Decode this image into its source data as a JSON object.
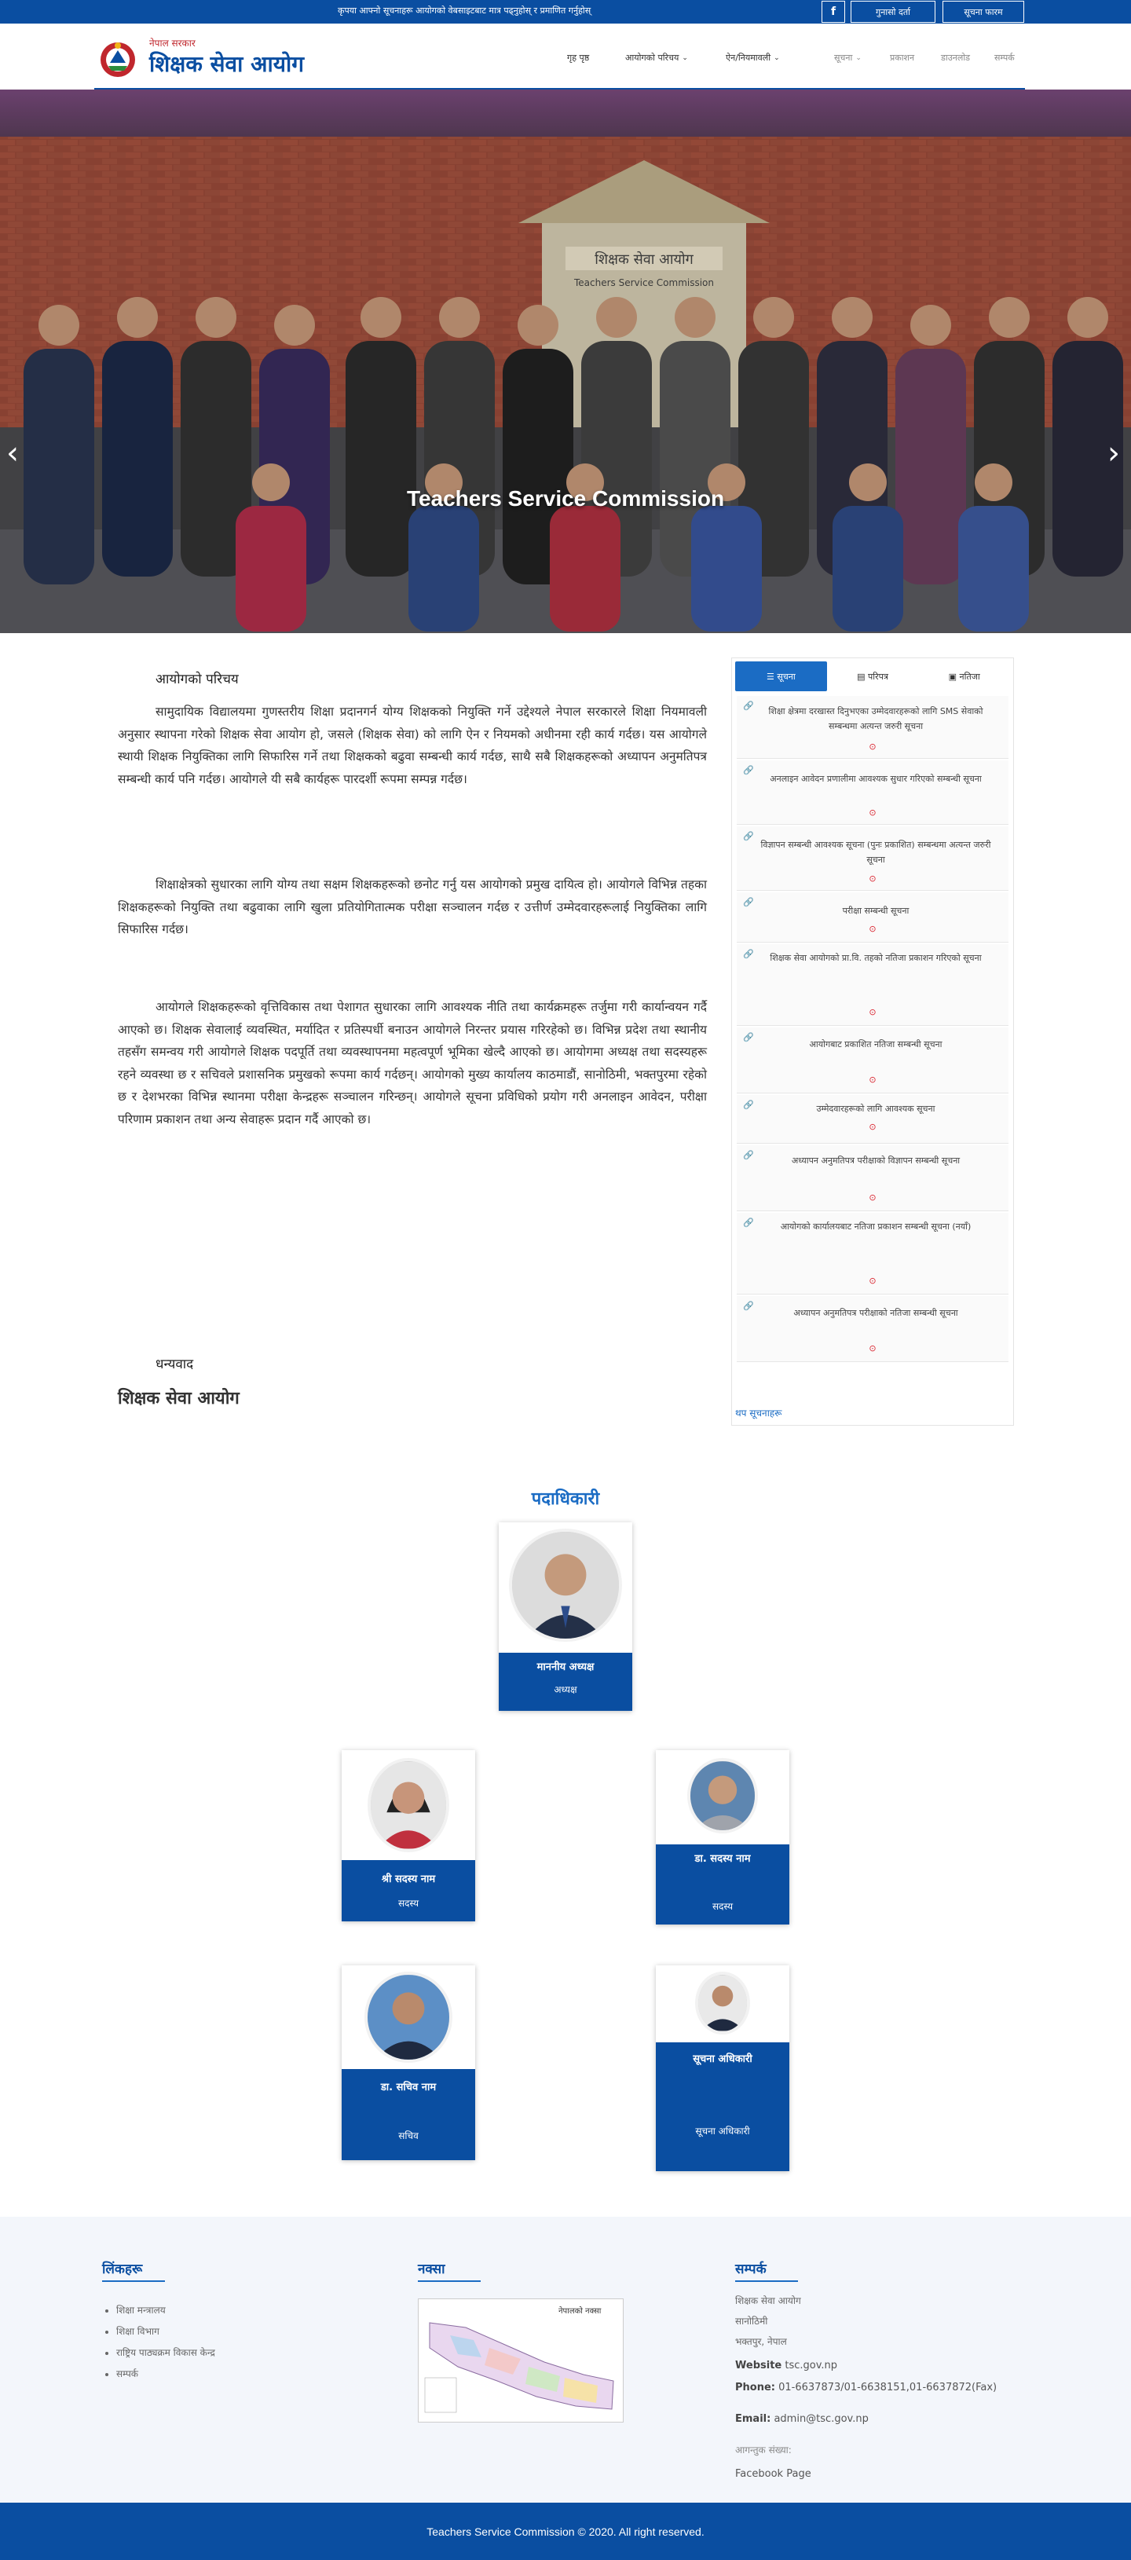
{
  "topbar": {
    "notice": "कृपया आफ्नो सूचनाहरू आयोगको वेबसाइटबाट मात्र पढ्नुहोस् र प्रमाणित गर्नुहोस्",
    "facebook_label": "f",
    "btn1": "गुनासो दर्ता",
    "btn2": "सूचना फारम"
  },
  "header": {
    "logo_small": "नेपाल सरकार",
    "logo_title": "शिक्षक सेवा आयोग",
    "nav": [
      {
        "label": "गृह पृष्ठ",
        "dropdown": false
      },
      {
        "label": "आयोगको परिचय",
        "dropdown": true
      },
      {
        "label": "ऐन/नियमावली",
        "dropdown": true
      },
      {
        "label": "सूचना",
        "dropdown": true
      },
      {
        "label": "प्रकाशन",
        "dropdown": false
      },
      {
        "label": "डाउनलोड",
        "dropdown": false
      },
      {
        "label": "सम्पर्क",
        "dropdown": false
      }
    ]
  },
  "hero": {
    "caption": "Teachers Service Commission",
    "sign_text": "शिक्षक सेवा आयोग",
    "sign_text_en": "Teachers Service Commission",
    "prev_icon": "chevron-left-icon",
    "next_icon": "chevron-right-icon"
  },
  "article": {
    "heading": "आयोगको परिचय",
    "paragraphs": [
      "सामुदायिक विद्यालयमा गुणस्तरीय शिक्षा प्रदानगर्न योग्य शिक्षकको नियुक्ति गर्ने उद्देश्यले नेपाल सरकारले शिक्षा नियमावली अनुसार स्थापना गरेको शिक्षक सेवा आयोग हो, जसले (शिक्षक सेवा) को लागि ऐन र नियमको अधीनमा रही कार्य गर्दछ। यस आयोगले स्थायी शिक्षक नियुक्तिका लागि सिफारिस गर्ने तथा शिक्षकको बढुवा सम्बन्धी कार्य गर्दछ, साथै सबै शिक्षकहरूको अध्यापन अनुमतिपत्र सम्बन्धी कार्य पनि गर्दछ। आयोगले यी सबै कार्यहरू पारदर्शी रूपमा सम्पन्न गर्दछ।",
      "शिक्षाक्षेत्रको सुधारका लागि योग्य तथा सक्षम शिक्षकहरूको छनोट गर्नु यस आयोगको प्रमुख दायित्व हो। आयोगले विभिन्न तहका शिक्षकहरूको नियुक्ति तथा बढुवाका लागि खुला प्रतियोगितात्मक परीक्षा सञ्चालन गर्दछ र उत्तीर्ण उम्मेदवारहरूलाई नियुक्तिका लागि सिफारिस गर्दछ।",
      "आयोगले शिक्षकहरूको वृत्तिविकास तथा पेशागत सुधारका लागि आवश्यक नीति तथा कार्यक्रमहरू तर्जुमा गरी कार्यान्वयन गर्दै आएको छ। शिक्षक सेवालाई व्यवस्थित, मर्यादित र प्रतिस्पर्धी बनाउन आयोगले निरन्तर प्रयास गरिरहेको छ। विभिन्न प्रदेश तथा स्थानीय तहसँग समन्वय गरी आयोगले शिक्षक पदपूर्ति तथा व्यवस्थापनमा महत्वपूर्ण भूमिका खेल्दै आएको छ। आयोगमा अध्यक्ष तथा सदस्यहरू रहने व्यवस्था छ र सचिवले प्रशासनिक प्रमुखको रूपमा कार्य गर्दछन्। आयोगको मुख्य कार्यालय काठमाडौं, सानोठिमी, भक्तपुरमा रहेको छ र देशभरका विभिन्न स्थानमा परीक्षा केन्द्रहरू सञ्चालन गरिन्छन्। आयोगले सूचना प्रविधिको प्रयोग गरी अनलाइन आवेदन, परीक्षा परिणाम प्रकाशन तथा अन्य सेवाहरू प्रदान गर्दै आएको छ।"
    ],
    "sign": "धन्यवाद",
    "big_text": "शिक्षक सेवा आयोग"
  },
  "panel": {
    "tabs": [
      {
        "label": "सूचना",
        "icon": "list-icon",
        "active": true
      },
      {
        "label": "परिपत्र",
        "icon": "document-icon",
        "active": false
      },
      {
        "label": "नतिजा",
        "icon": "briefcase-icon",
        "active": false
      }
    ],
    "notices": [
      "शिक्षा क्षेत्रमा दरखास्त दिनुभएका उम्मेदवारहरूको लागि SMS सेवाको सम्बन्धमा अत्यन्त जरुरी सूचना",
      "अनलाइन आवेदन प्रणालीमा आवश्यक सुधार गरिएको सम्बन्धी सूचना",
      "विज्ञापन सम्बन्धी आवश्यक सूचना (पुनः प्रकाशित) सम्बन्धमा अत्यन्त जरुरी सूचना",
      "परीक्षा सम्बन्धी सूचना",
      "शिक्षक सेवा आयोगको प्रा.वि. तहको नतिजा प्रकाशन गरिएको सूचना",
      "आयोगबाट प्रकाशित नतिजा सम्बन्धी सूचना",
      "उम्मेदवारहरूको लागि आवश्यक सूचना",
      "अध्यापन अनुमतिपत्र परीक्षाको विज्ञापन सम्बन्धी सूचना",
      "आयोगको कार्यालयबाट नतिजा प्रकाशन सम्बन्धी सूचना (नयाँ)",
      "अध्यापन अनुमतिपत्र परीक्षाको नतिजा सम्बन्धी सूचना"
    ],
    "more": "थप सूचनाहरू"
  },
  "officials": {
    "title": "पदाधिकारी",
    "people": [
      {
        "name": "माननीय अध्यक्ष",
        "role": "अध्यक्ष"
      },
      {
        "name": "श्री सदस्य नाम",
        "role": "सदस्य"
      },
      {
        "name": "डा. सदस्य नाम",
        "role": "सदस्य"
      },
      {
        "name": "डा. सचिव नाम",
        "role": "सचिव"
      },
      {
        "name": "सूचना अधिकारी",
        "role": "सूचना अधिकारी"
      }
    ]
  },
  "footer": {
    "links_title": "लिंकहरू",
    "links": [
      "शिक्षा मन्त्रालय",
      "शिक्षा विभाग",
      "राष्ट्रिय पाठ्यक्रम विकास केन्द्र",
      "सम्पर्क"
    ],
    "map_title": "नक्सा",
    "map_label": "नेपालको नक्सा",
    "contact_title": "सम्पर्क",
    "address1": "शिक्षक सेवा आयोग",
    "address2": "सानोठिमी",
    "address3": "भक्तपुर, नेपाल",
    "website_label": "Website",
    "website": "tsc.gov.np",
    "phone_label": "Phone:",
    "phone": "01-6637873/01-6638151,01-6637872(Fax)",
    "email_label": "Email:",
    "email": "admin@tsc.gov.np",
    "visitors_label": "आगन्तुक संख्या:",
    "visitors": "",
    "facebook": "Facebook Page",
    "copyright": "Teachers Service Commission © 2020. All right reserved."
  }
}
